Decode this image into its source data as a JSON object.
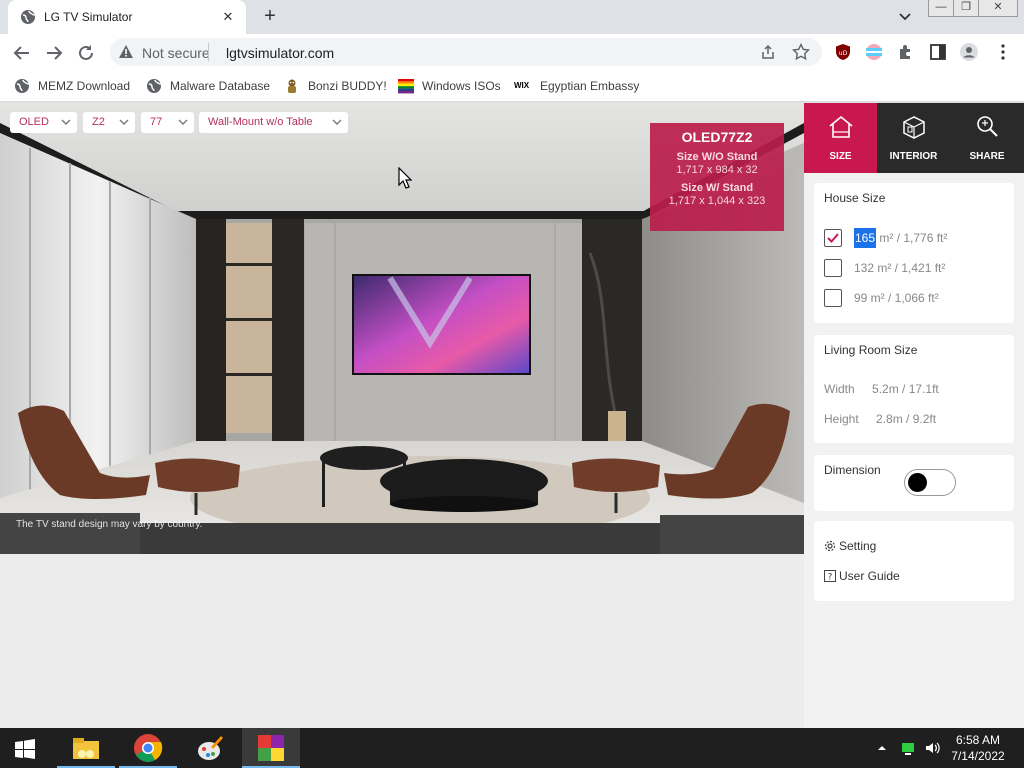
{
  "browser": {
    "tab_title": "LG TV Simulator",
    "new_tab": "+",
    "omnibox": {
      "security_text": "Not secure",
      "url": "lgtvsimulator.com"
    },
    "bookmarks": [
      {
        "label": "MEMZ Download",
        "icon": "globe-icon"
      },
      {
        "label": "Malware Database",
        "icon": "globe-icon"
      },
      {
        "label": "Bonzi BUDDY!",
        "icon": "bonzi-icon"
      },
      {
        "label": "Windows ISOs",
        "icon": "windows-flag-icon"
      },
      {
        "label": "Egyptian Embassy",
        "icon": "wix-icon",
        "icon_text": "WIX"
      }
    ]
  },
  "simulator": {
    "dropdowns": [
      {
        "label": "OLED"
      },
      {
        "label": "Z2"
      },
      {
        "label": "77"
      },
      {
        "label": "Wall-Mount w/o Table"
      }
    ],
    "info_box": {
      "model": "OLED77Z2",
      "without_stand_label": "Size W/O Stand",
      "without_stand_value": "1,717 x 984 x 32",
      "with_stand_label": "Size W/ Stand",
      "with_stand_value": "1,717 x 1,044 x 323"
    },
    "disclaimer": "The TV stand design may vary by country."
  },
  "panel": {
    "nav": [
      {
        "label": "SIZE",
        "icon": "house-icon",
        "active": true
      },
      {
        "label": "INTERIOR",
        "icon": "interior-icon",
        "active": false
      },
      {
        "label": "SHARE",
        "icon": "search-icon",
        "active": false
      }
    ],
    "house_size": {
      "title": "House Size",
      "options": [
        {
          "highlight": "165",
          "rest": " m² / 1,776 ft²",
          "checked": true
        },
        {
          "text": "132 m² / 1,421 ft²",
          "checked": false
        },
        {
          "text": "99 m² / 1,066 ft²",
          "checked": false
        }
      ]
    },
    "living_room": {
      "title": "Living Room Size",
      "width_label": "Width",
      "width_value": "5.2m / 17.1ft",
      "height_label": "Height",
      "height_value": "2.8m / 9.2ft"
    },
    "dimension": {
      "title": "Dimension",
      "on": false
    },
    "links": {
      "setting": "Setting",
      "user_guide": "User Guide"
    }
  },
  "taskbar": {
    "time": "6:58 AM",
    "date": "7/14/2022"
  },
  "colors": {
    "accent": "#c8184f",
    "dropdown_text": "#b5305c",
    "selection": "#1a73e8"
  }
}
